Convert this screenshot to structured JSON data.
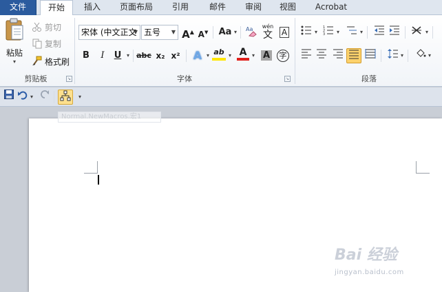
{
  "tabs": [
    {
      "label": "文件"
    },
    {
      "label": "开始"
    },
    {
      "label": "插入"
    },
    {
      "label": "页面布局"
    },
    {
      "label": "引用"
    },
    {
      "label": "邮件"
    },
    {
      "label": "审阅"
    },
    {
      "label": "视图"
    },
    {
      "label": "Acrobat"
    }
  ],
  "clipboard": {
    "paste": "粘贴",
    "cut": "剪切",
    "copy": "复制",
    "format_painter": "格式刷",
    "group_label": "剪贴板"
  },
  "font": {
    "font_name": "宋体 (中文正文",
    "font_size": "五号",
    "change_case": "Aa",
    "bold": "B",
    "italic": "I",
    "underline": "U",
    "strike": "abc",
    "subscript": "x₂",
    "superscript": "x²",
    "grow": "A",
    "shrink": "A",
    "pinyin": "wén",
    "pinyin_char": "文",
    "border_char": "A",
    "highlight": "ab",
    "font_color": "A",
    "shading_char": "A",
    "enclose_char": "字",
    "group_label": "字体"
  },
  "paragraph": {
    "group_label": "段落"
  },
  "qat": {
    "tooltip": "Normal.NewMacros.宏1"
  },
  "watermark": {
    "brand": "Bai 经验",
    "url": "jingyan.baidu.com"
  },
  "colors": {
    "file_tab": "#2b5b9e",
    "highlight_yellow": "#ffe600",
    "font_red": "#e0201b",
    "selected_button": "#fcd26b"
  }
}
